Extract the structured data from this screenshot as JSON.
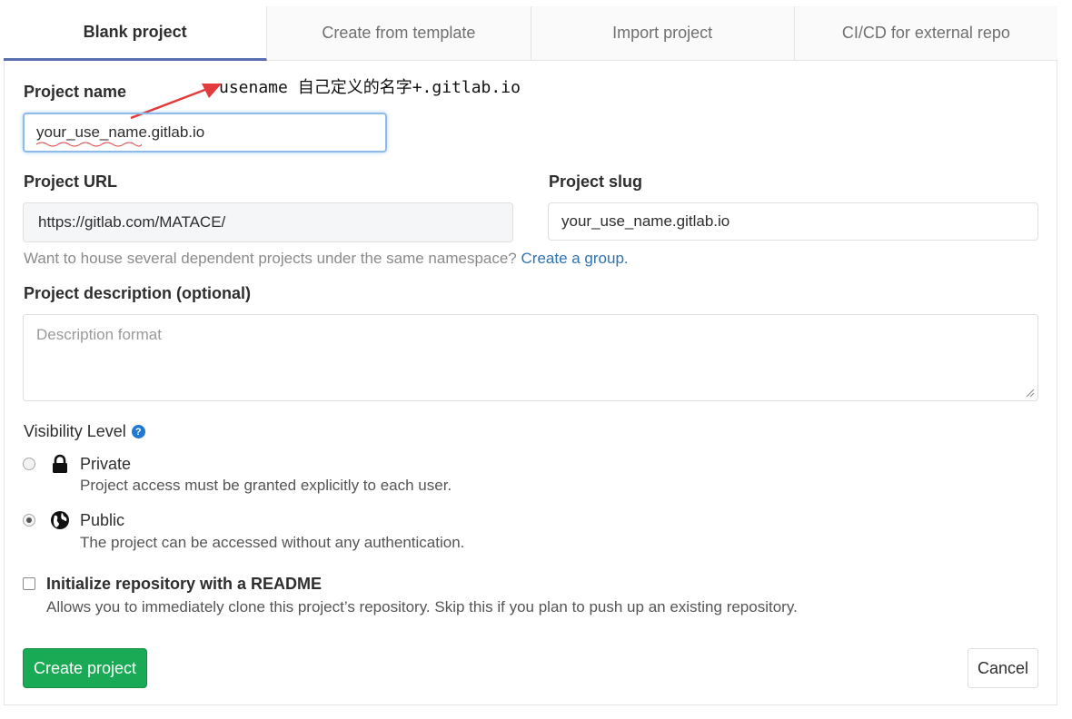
{
  "tabs": [
    {
      "label": "Blank project",
      "active": true
    },
    {
      "label": "Create from template",
      "active": false
    },
    {
      "label": "Import project",
      "active": false
    },
    {
      "label": "CI/CD for external repo",
      "active": false
    }
  ],
  "form": {
    "project_name_label": "Project name",
    "project_name_value": "your_use_name.gitlab.io",
    "annotation_text": "usename 自己定义的名字+.gitlab.io",
    "project_url_label": "Project URL",
    "project_url_value": "https://gitlab.com/MATACE/",
    "project_slug_label": "Project slug",
    "project_slug_value": "your_use_name.gitlab.io",
    "namespace_help": "Want to house several dependent projects under the same namespace?",
    "create_group_link": "Create a group.",
    "description_label": "Project description (optional)",
    "description_placeholder": "Description format",
    "visibility_label": "Visibility Level",
    "visibility_options": [
      {
        "title": "Private",
        "description": "Project access must be granted explicitly to each user.",
        "icon": "lock-icon",
        "checked": false
      },
      {
        "title": "Public",
        "description": "The project can be accessed without any authentication.",
        "icon": "globe-icon",
        "checked": true
      }
    ],
    "readme_label": "Initialize repository with a README",
    "readme_description": "Allows you to immediately clone this project’s repository. Skip this if you plan to push up an existing repository.",
    "create_button": "Create project",
    "cancel_button": "Cancel"
  },
  "colors": {
    "primary_green": "#1aaa55",
    "link_blue": "#2f73b2",
    "active_tab_border": "#5b6fb0",
    "annotation_red": "#e23b3b"
  }
}
